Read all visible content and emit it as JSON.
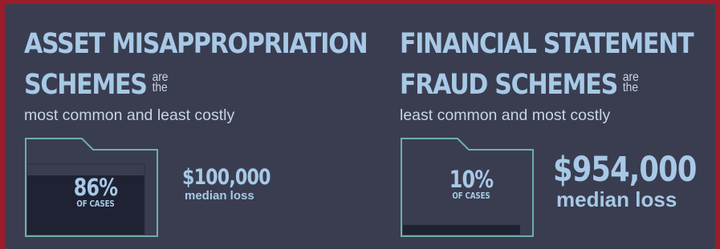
{
  "left": {
    "title_line1": "ASSET MISAPPROPRIATION",
    "title_line2": "SCHEMES",
    "small_top": "are",
    "small_bottom": "the",
    "subtitle": "most common and least costly",
    "percent": "86%",
    "percent_caption": "OF CASES",
    "amount": "$100,000",
    "amount_caption": "median loss",
    "fill_fraction": 0.86
  },
  "right": {
    "title_line1": "FINANCIAL STATEMENT",
    "title_line2": "FRAUD SCHEMES",
    "small_top": "are",
    "small_bottom": "the",
    "subtitle": "least common and most costly",
    "percent": "10%",
    "percent_caption": "OF CASES",
    "amount": "$954,000",
    "amount_caption": "median loss",
    "fill_fraction": 0.1
  },
  "colors": {
    "background": "#3a3d50",
    "border": "#9b1c2a",
    "heading": "#a7c9e6",
    "folder_outline": "#6fb0a4",
    "folder_fill": "#1f2233"
  }
}
